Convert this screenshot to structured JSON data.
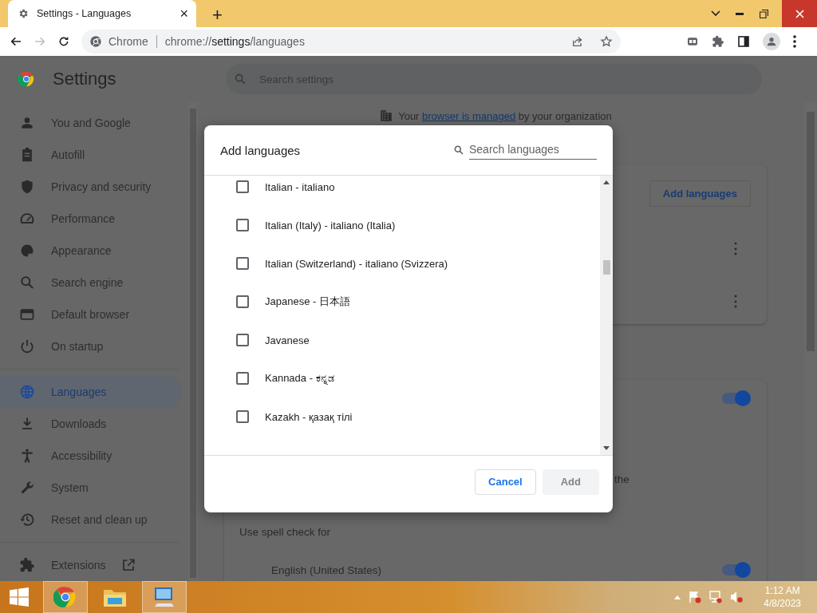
{
  "browser": {
    "tab": {
      "title": "Settings - Languages",
      "close": "×"
    },
    "new_tab": "+",
    "address_bar": {
      "site_label": "Chrome",
      "url_scheme": "chrome://",
      "url_host": "settings",
      "url_path": "/languages"
    }
  },
  "settings": {
    "title": "Settings",
    "search": {
      "placeholder": "Search settings"
    },
    "sidebar": {
      "groups": [
        [
          {
            "label": "You and Google",
            "selected": false
          },
          {
            "label": "Autofill",
            "selected": false
          },
          {
            "label": "Privacy and security",
            "selected": false
          },
          {
            "label": "Performance",
            "selected": false
          },
          {
            "label": "Appearance",
            "selected": false
          },
          {
            "label": "Search engine",
            "selected": false
          },
          {
            "label": "Default browser",
            "selected": false
          },
          {
            "label": "On startup",
            "selected": false
          }
        ],
        [
          {
            "label": "Languages",
            "selected": true
          },
          {
            "label": "Downloads",
            "selected": false
          },
          {
            "label": "Accessibility",
            "selected": false
          },
          {
            "label": "System",
            "selected": false
          },
          {
            "label": "Reset and clean up",
            "selected": false
          }
        ]
      ],
      "external_link": {
        "label": "Extensions"
      }
    },
    "managed_notice": {
      "before": "Your",
      "link": "browser is managed",
      "after": "by your organization"
    },
    "languages_card": {
      "button": "Add languages",
      "rows": [
        {
          "menu": "⋮"
        },
        {
          "menu": "⋮"
        }
      ]
    },
    "spell_card": {
      "toggle": {
        "on": true
      },
      "description_fragment": "the",
      "spell_check_label": "Use spell check for",
      "languages": [
        {
          "label": "English (United States)",
          "on": true
        }
      ]
    }
  },
  "dialog": {
    "title": "Add languages",
    "search": {
      "placeholder": "Search languages"
    },
    "languages": [
      {
        "label": "Italian - italiano",
        "checked": false
      },
      {
        "label": "Italian (Italy) - italiano (Italia)",
        "checked": false
      },
      {
        "label": "Italian (Switzerland) - italiano (Svizzera)",
        "checked": false
      },
      {
        "label": "Japanese - 日本語",
        "checked": false
      },
      {
        "label": "Javanese",
        "checked": false
      },
      {
        "label": "Kannada - ಕನ್ನಡ",
        "checked": false
      },
      {
        "label": "Kazakh - қазақ тілі",
        "checked": false
      }
    ],
    "buttons": [
      {
        "label": "Cancel",
        "kind": "secondary",
        "disabled": false
      },
      {
        "label": "Add",
        "kind": "primary",
        "disabled": true
      }
    ]
  },
  "taskbar": {
    "clock": {
      "time": "1:12 AM",
      "date": "4/8/2023"
    }
  }
}
